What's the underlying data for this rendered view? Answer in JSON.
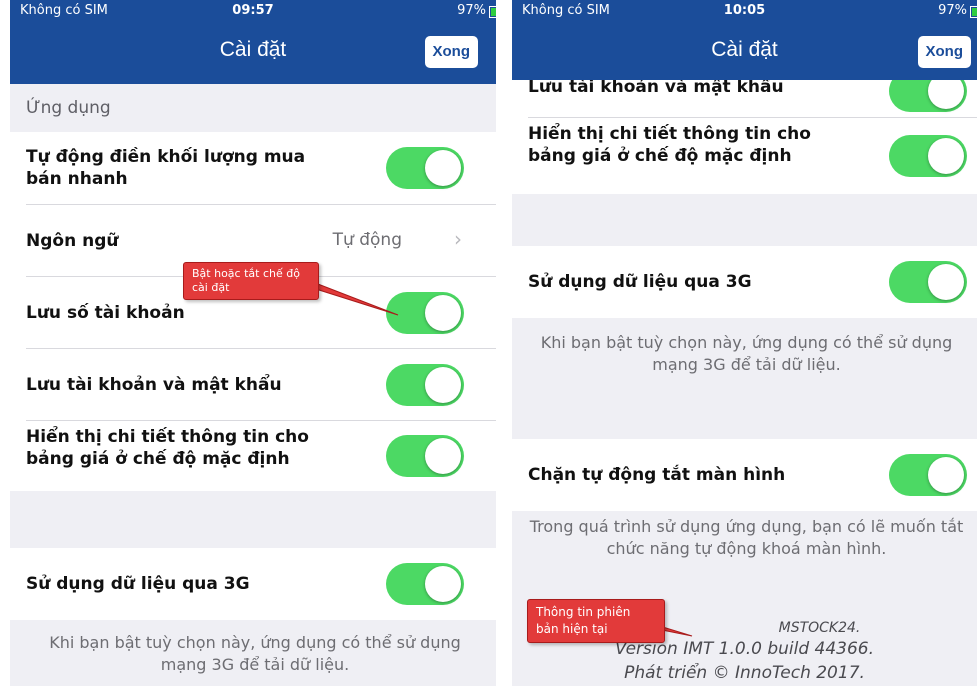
{
  "status_left": {
    "carrier": "Không có SIM",
    "time": "09:57",
    "battery": "97%"
  },
  "status_right": {
    "carrier": "Không có SIM",
    "time": "10:05",
    "battery": "97%"
  },
  "navbar": {
    "title": "Cài đặt",
    "done_label": "Xong"
  },
  "left": {
    "section_app": "Ứng dụng",
    "auto_fill_label": "Tự động điền khối lượng mua bán nhanh",
    "language_label": "Ngôn ngữ",
    "language_value": "Tự động",
    "save_account_label": "Lưu số tài khoản",
    "save_account_password_label": "Lưu tài khoản và mật khẩu",
    "show_price_detail_label": "Hiển thị chi tiết thông tin cho bảng giá ở chế độ mặc định",
    "use_3g_label": "Sử dụng dữ liệu qua 3G",
    "use_3g_footer": "Khi bạn bật tuỳ chọn này, ứng dụng có thể sử dụng mạng 3G để tải dữ liệu."
  },
  "right": {
    "partial_row_label": "Lưu tài khoản và mật khẩu",
    "show_price_detail_label": "Hiển thị chi tiết thông tin cho bảng giá ở chế độ mặc định",
    "use_3g_label": "Sử dụng dữ liệu qua 3G",
    "use_3g_footer": "Khi bạn bật tuỳ chọn này, ứng dụng có thể sử dụng mạng 3G để tải dữ liệu.",
    "keep_screen_on_label": "Chặn tự động tắt màn hình",
    "keep_screen_on_footer": "Trong quá trình sử dụng ứng dụng, bạn có lẽ muốn tắt chức năng tự động khoá màn hình.",
    "app_name": "MSTOCK24.",
    "version": "Version IMT 1.0.0 build 44366.",
    "developer": "Phát triển © InnoTech 2017."
  },
  "callouts": {
    "toggle_hint": "Bật hoặc tắt chế độ cài đặt",
    "version_hint": "Thông tin phiên bản hiện tại"
  },
  "toggles": {
    "auto_fill": true,
    "save_account": true,
    "save_account_password": true,
    "show_price_detail": true,
    "use_3g": true,
    "keep_screen_on": true
  },
  "colors": {
    "navbar": "#1b4d9a",
    "toggle_on": "#4cd964",
    "callout": "#e23a3a"
  }
}
